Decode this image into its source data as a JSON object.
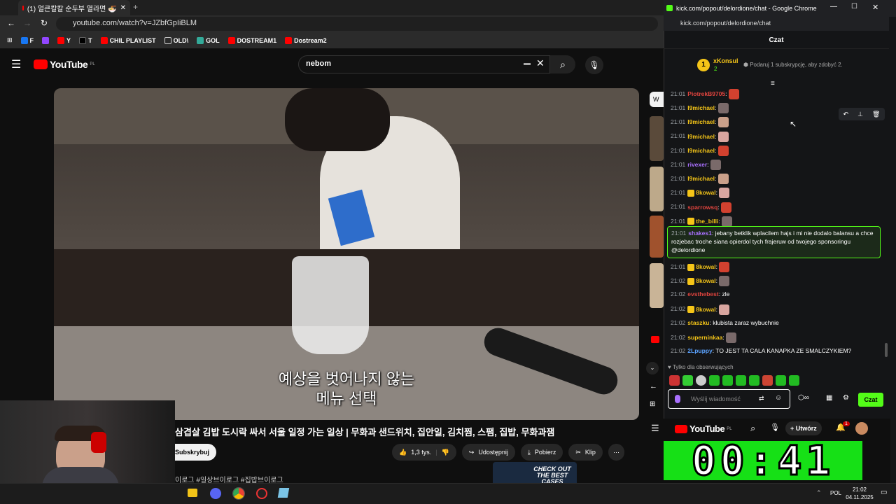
{
  "browser": {
    "tab_title": "(1) 얼큰칼칼 순두부 열라면 🍜",
    "url": "youtube.com/watch?v=JZbfGpIiBLM",
    "bookmarks": [
      "F",
      "Y",
      "T",
      "CHIL PLAYLIST",
      "OLD\\",
      "GOL",
      "DOSTREAM1",
      "Dostream2"
    ]
  },
  "youtube": {
    "logo": "YouTube",
    "region": "PL",
    "search_value": "nebom",
    "subtitle_line1": "예상을 벗어나지 않는",
    "subtitle_line2": "메뉴 선택",
    "title": "삼겹살 김밥 도시락 싸서 서울 일정 가는 일상 | 무화과 샌드위치, 집안일, 김치찜, 스팸, 집밥, 무화과잼",
    "subscribe": "Subskrybuj",
    "likes": "1,3 tys.",
    "share": "Udostępnij",
    "download": "Pobierz",
    "clip": "Klip",
    "hashtags": "이로그 #일상브이로그 #집밥브이로그",
    "ad_text": "CHECK OUT THE BEST CASES"
  },
  "kick": {
    "window_title": "kick.com/popout/delordione/chat - Google Chrome",
    "url": "kick.com/popout/delordione/chat",
    "header": "Czat",
    "top_user": "xKonsul",
    "top_rank": "1",
    "top_count": "2",
    "gift_text": "Podaruj 1 subskrypcję, aby zdobyć 2.",
    "messages": [
      {
        "time": "21:01",
        "user": "PiotrekB9705",
        "text": "",
        "color": "#e0443e"
      },
      {
        "time": "21:01",
        "user": "l9michael",
        "text": "",
        "color": "#f2c318"
      },
      {
        "time": "21:01",
        "user": "l9michael",
        "text": "",
        "color": "#f2c318"
      },
      {
        "time": "21:01",
        "user": "l9michael",
        "text": "",
        "color": "#f2c318"
      },
      {
        "time": "21:01",
        "user": "l9michael",
        "text": "",
        "color": "#f2c318"
      },
      {
        "time": "21:01",
        "user": "rivexer",
        "text": "",
        "color": "#a970ff"
      },
      {
        "time": "21:01",
        "user": "l9michael",
        "text": "",
        "color": "#f2c318"
      },
      {
        "time": "21:01",
        "user": "8kowal",
        "text": "",
        "color": "#f2c318"
      },
      {
        "time": "21:01",
        "user": "sparrowsq",
        "text": "",
        "color": "#e0443e"
      },
      {
        "time": "21:01",
        "user": "the_billi",
        "text": "",
        "color": "#f2c318"
      }
    ],
    "highlight": {
      "time": "21:01",
      "user": "shakes1",
      "text": "jebany betklik wplacilem hajs i mi nie dodalo balansu a chce rozjebac troche siana opierdol tych frajeruw od twojego sponsoringu @delordione"
    },
    "messages2": [
      {
        "time": "21:01",
        "user": "8kowal",
        "text": "",
        "color": "#f2c318"
      },
      {
        "time": "21:02",
        "user": "8kowal",
        "text": "",
        "color": "#f2c318"
      },
      {
        "time": "21:02",
        "user": "evsthebest",
        "text": "zle",
        "color": "#e0443e"
      },
      {
        "time": "21:02",
        "user": "8kowal",
        "text": "",
        "color": "#f2c318"
      },
      {
        "time": "21:02",
        "user": "staszku",
        "text": "klubista zaraz wybuchnie",
        "color": "#f2c318"
      },
      {
        "time": "21:02",
        "user": "superninkaa",
        "text": "",
        "color": "#f2c318"
      },
      {
        "time": "21:02",
        "user": "2Lpuppy",
        "text": "TO JEST TA CALA KANAPKA ZE SMALCZYKIEM?",
        "color": "#5ba3ff"
      }
    ],
    "followers_only": "Tylko dla obserwujących",
    "input_placeholder": "Wyślij wiadomość",
    "send_label": "Czat"
  },
  "mini_youtube": {
    "logo": "YouTube",
    "region": "PL",
    "create": "Utwórz",
    "notif": "1",
    "clock": "00:41"
  },
  "taskbar": {
    "lang": "POL",
    "time": "21:02",
    "date": "04.11.2025"
  }
}
